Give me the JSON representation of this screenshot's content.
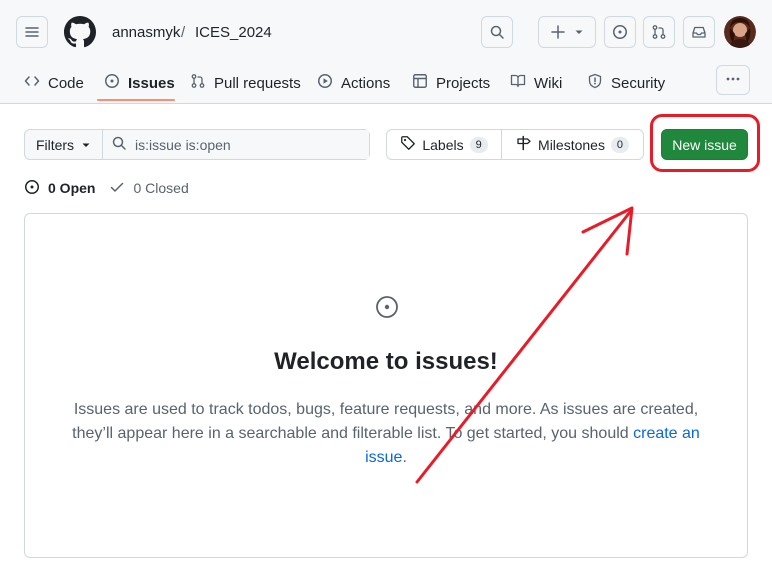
{
  "header": {
    "owner": "annasmyk",
    "separator": "/",
    "repo": "ICES_2024",
    "icons": [
      "menu-icon",
      "github-logo",
      "search-icon",
      "plus-icon",
      "chevron-down-icon",
      "issue-opened-icon",
      "pull-request-icon",
      "inbox-icon",
      "avatar"
    ]
  },
  "tabs": [
    {
      "label": "Code",
      "icon": "code-icon",
      "active": false
    },
    {
      "label": "Issues",
      "icon": "issue-opened-icon",
      "active": true
    },
    {
      "label": "Pull requests",
      "icon": "pull-request-icon",
      "active": false
    },
    {
      "label": "Actions",
      "icon": "play-icon",
      "active": false
    },
    {
      "label": "Projects",
      "icon": "table-icon",
      "active": false
    },
    {
      "label": "Wiki",
      "icon": "book-icon",
      "active": false
    },
    {
      "label": "Security",
      "icon": "shield-icon",
      "active": false
    }
  ],
  "toolbar": {
    "filters_label": "Filters",
    "search_placeholder": "is:issue is:open",
    "labels_label": "Labels",
    "labels_count": "9",
    "milestones_label": "Milestones",
    "milestones_count": "0",
    "new_issue_label": "New issue"
  },
  "states": {
    "open_label": "0 Open",
    "closed_label": "0 Closed"
  },
  "blankslate": {
    "title": "Welcome to issues!",
    "description": "Issues are used to track todos, bugs, feature requests, and more. As issues are created, they’ll appear here in a searchable and filterable list. To get started, you should ",
    "link_text": "create an issue",
    "trailing": "."
  },
  "colors": {
    "primary_button": "#1f883d",
    "active_tab_underline": "#fd8c73",
    "link": "#0969da",
    "annotation_red": "#e81c28"
  }
}
